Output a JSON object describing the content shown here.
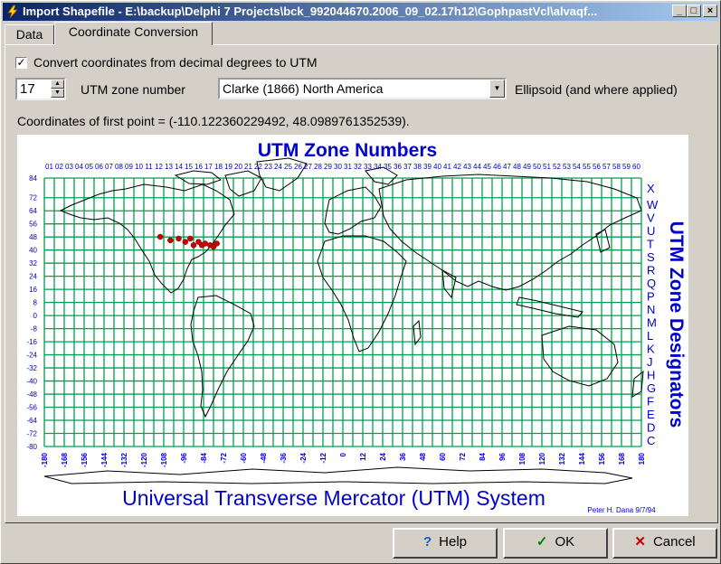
{
  "window": {
    "title": "Import Shapefile - E:\\backup\\Delphi 7 Projects\\bck_992044670.2006_09_02.17h12\\GophpastVcl\\alvaqf...",
    "minimize": "_",
    "maximize": "□",
    "close": "×"
  },
  "tabs": [
    {
      "label": "Data"
    },
    {
      "label": "Coordinate Conversion"
    }
  ],
  "convert": {
    "checked": true,
    "check_mark": "✓",
    "label": "Convert coordinates from decimal degrees to UTM"
  },
  "zone": {
    "value": "17",
    "label": "UTM zone number"
  },
  "ellipsoid": {
    "value": "Clarke (1866) North America",
    "label": "Ellipsoid (and where applied)"
  },
  "first_point": "Coordinates of first point = (-110.122360229492, 48.0989761352539).",
  "map": {
    "title": "UTM Zone Numbers",
    "side_title": "UTM Zone Designators",
    "bottom_title": "Universal Transverse Mercator (UTM) System",
    "credit": "Peter H. Dana 9/7/94",
    "zone_numbers": [
      "01",
      "02",
      "03",
      "04",
      "05",
      "06",
      "07",
      "08",
      "09",
      "10",
      "11",
      "12",
      "13",
      "14",
      "15",
      "16",
      "17",
      "18",
      "19",
      "20",
      "21",
      "22",
      "23",
      "24",
      "25",
      "26",
      "27",
      "28",
      "29",
      "30",
      "31",
      "32",
      "33",
      "34",
      "35",
      "36",
      "37",
      "38",
      "39",
      "40",
      "41",
      "42",
      "43",
      "44",
      "45",
      "46",
      "47",
      "48",
      "49",
      "50",
      "51",
      "52",
      "53",
      "54",
      "55",
      "56",
      "57",
      "58",
      "59",
      "60"
    ],
    "lat_labels": [
      "84",
      "72",
      "64",
      "56",
      "48",
      "40",
      "32",
      "24",
      "16",
      "8",
      "0",
      "-8",
      "-16",
      "-24",
      "-32",
      "-40",
      "-48",
      "-56",
      "-64",
      "-72",
      "-80"
    ],
    "designators": [
      "X",
      "W",
      "V",
      "U",
      "T",
      "S",
      "R",
      "Q",
      "P",
      "N",
      "M",
      "L",
      "K",
      "J",
      "H",
      "G",
      "F",
      "E",
      "D",
      "C"
    ],
    "lon_labels": [
      "-180",
      "-168",
      "-156",
      "-144",
      "-132",
      "-120",
      "-108",
      "-96",
      "-84",
      "-72",
      "-60",
      "-48",
      "-36",
      "-24",
      "-12",
      "0",
      "12",
      "24",
      "36",
      "48",
      "60",
      "72",
      "84",
      "96",
      "108",
      "120",
      "132",
      "144",
      "156",
      "168",
      "180"
    ],
    "colors": {
      "grid": "#00a050",
      "title": "#0000cc",
      "points": "#cc0000"
    }
  },
  "buttons": {
    "help": {
      "label": "Help",
      "icon": "?"
    },
    "ok": {
      "label": "OK",
      "icon": "✓"
    },
    "cancel": {
      "label": "Cancel",
      "icon": "✕"
    }
  }
}
